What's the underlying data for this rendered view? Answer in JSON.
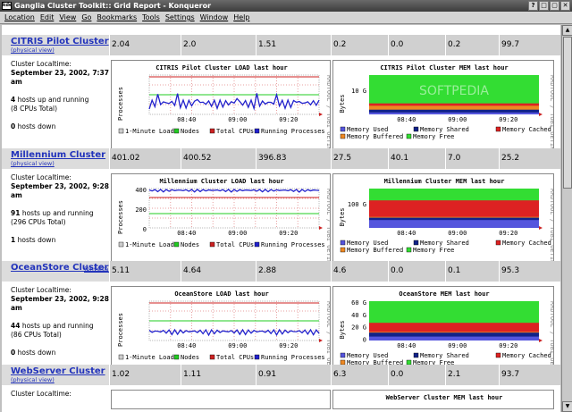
{
  "window": {
    "title": "Ganglia Cluster Toolkit:: Grid Report - Konqueror",
    "icon": "kde-app-icon",
    "buttons": [
      "?",
      "□",
      "▢",
      "✕"
    ]
  },
  "menu": [
    "Location",
    "Edit",
    "View",
    "Go",
    "Bookmarks",
    "Tools",
    "Settings",
    "Window",
    "Help"
  ],
  "clusters": [
    {
      "name": "CITRIS Pilot Cluster",
      "physical_view": "(physical view)",
      "metrics": [
        "2.04",
        "2.0",
        "1.51",
        "0.2",
        "0.0",
        "0.2",
        "99.7"
      ],
      "localtime_label": "Cluster Localtime:",
      "localtime": "September 23, 2002, 7:37 am",
      "hosts_up": "4",
      "hosts_up_text": " hosts up and running",
      "cpus": "(8 CPUs Total)",
      "hosts_down": "0",
      "hosts_down_text": " hosts down",
      "load_title": "CITRIS Pilot Cluster LOAD last hour",
      "mem_title": "CITRIS Pilot Cluster MEM last hour",
      "load_y": "Processes",
      "mem_y": "Bytes",
      "mem_tick": "10 G"
    },
    {
      "name": "Millennium Cluster",
      "physical_view": "(physical view)",
      "metrics": [
        "401.02",
        "400.52",
        "396.83",
        "27.5",
        "40.1",
        "7.0",
        "25.2"
      ],
      "localtime_label": "Cluster Localtime:",
      "localtime": "September 23, 2002, 9:28 am",
      "hosts_up": "91",
      "hosts_up_text": " hosts up and running",
      "cpus": "(296 CPUs Total)",
      "hosts_down": "1",
      "hosts_down_text": " hosts down",
      "load_title": "Millennium Cluster LOAD last hour",
      "mem_title": "Millennium Cluster MEM last hour",
      "load_y": "Processes",
      "mem_y": "Bytes",
      "load_ticks": [
        "400",
        "200",
        "0"
      ],
      "mem_tick": "100 G"
    },
    {
      "name": "OceanStore Cluster",
      "physical_view": "(physical view)",
      "metrics": [
        "5.11",
        "4.64",
        "2.88",
        "4.6",
        "0.0",
        "0.1",
        "95.3"
      ],
      "localtime_label": "Cluster Localtime:",
      "localtime": "September 23, 2002, 9:28 am",
      "hosts_up": "44",
      "hosts_up_text": " hosts up and running",
      "cpus": "(86 CPUs Total)",
      "hosts_down": "0",
      "hosts_down_text": " hosts down",
      "load_title": "OceanStore LOAD last hour",
      "mem_title": "OceanStore MEM last hour",
      "load_y": "Processes",
      "mem_y": "Bytes",
      "mem_ticks": [
        "60 G",
        "40 G",
        "20 G",
        "0"
      ]
    },
    {
      "name": "WebServer Cluster",
      "physical_view": "(physical view)",
      "metrics": [
        "1.02",
        "1.11",
        "0.91",
        "6.3",
        "0.0",
        "2.1",
        "93.7"
      ],
      "localtime_label": "Cluster Localtime:",
      "mem_title": "WebServer Cluster MEM last hour"
    }
  ],
  "x_ticks": [
    "08:40",
    "09:00",
    "09:20"
  ],
  "load_legend": [
    {
      "label": "1-Minute Load",
      "color": "#cccccc"
    },
    {
      "label": "Nodes",
      "color": "#22cc22"
    },
    {
      "label": "Total CPUs",
      "color": "#cc2222"
    },
    {
      "label": "Running Processes",
      "color": "#2222cc"
    }
  ],
  "mem_legend": [
    {
      "label": "Memory Used",
      "color": "#5555dd"
    },
    {
      "label": "Memory Shared",
      "color": "#112288"
    },
    {
      "label": "Memory Cached",
      "color": "#dd2222"
    },
    {
      "label": "Memory Buffered",
      "color": "#ee8822"
    },
    {
      "label": "Memory Free",
      "color": "#33dd33"
    }
  ],
  "rrd_text": "RRDTOOL / TOBI OETIKER",
  "watermark": "SOFTPEDIA"
}
